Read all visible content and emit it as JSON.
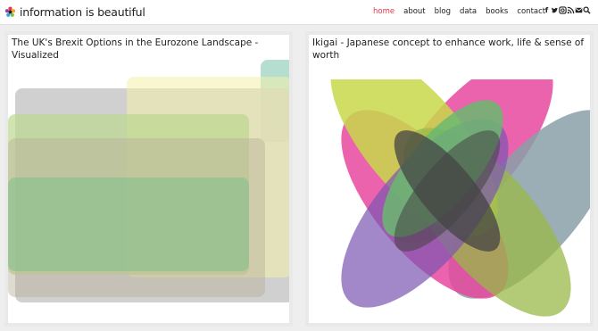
{
  "site": {
    "logo_text": "information is beautiful",
    "logo_icon": "flower-logo-icon"
  },
  "nav": {
    "items": [
      {
        "label": "home",
        "active": true
      },
      {
        "label": "about",
        "active": false
      },
      {
        "label": "blog",
        "active": false
      },
      {
        "label": "data",
        "active": false
      },
      {
        "label": "books",
        "active": false
      },
      {
        "label": "contact",
        "active": false
      }
    ],
    "active_color": "#e5364a"
  },
  "social_icons": [
    "facebook-icon",
    "twitter-icon",
    "instagram-icon",
    "rss-icon",
    "email-icon",
    "search-icon"
  ],
  "cards": [
    {
      "title": "The UK's Brexit Options in the Eurozone Landscape - Visualized",
      "colors": [
        "#c8c8c8",
        "#f2f1a8",
        "#a8d8c8",
        "#bcd890",
        "#8fc08e"
      ]
    },
    {
      "title": "Ikigai - Japanese concept to enhance work, life & sense of worth",
      "colors": [
        "#e8489e",
        "#c8d84a",
        "#8aa0a8",
        "#6bb870",
        "#7a55b0",
        "#444444"
      ]
    }
  ]
}
